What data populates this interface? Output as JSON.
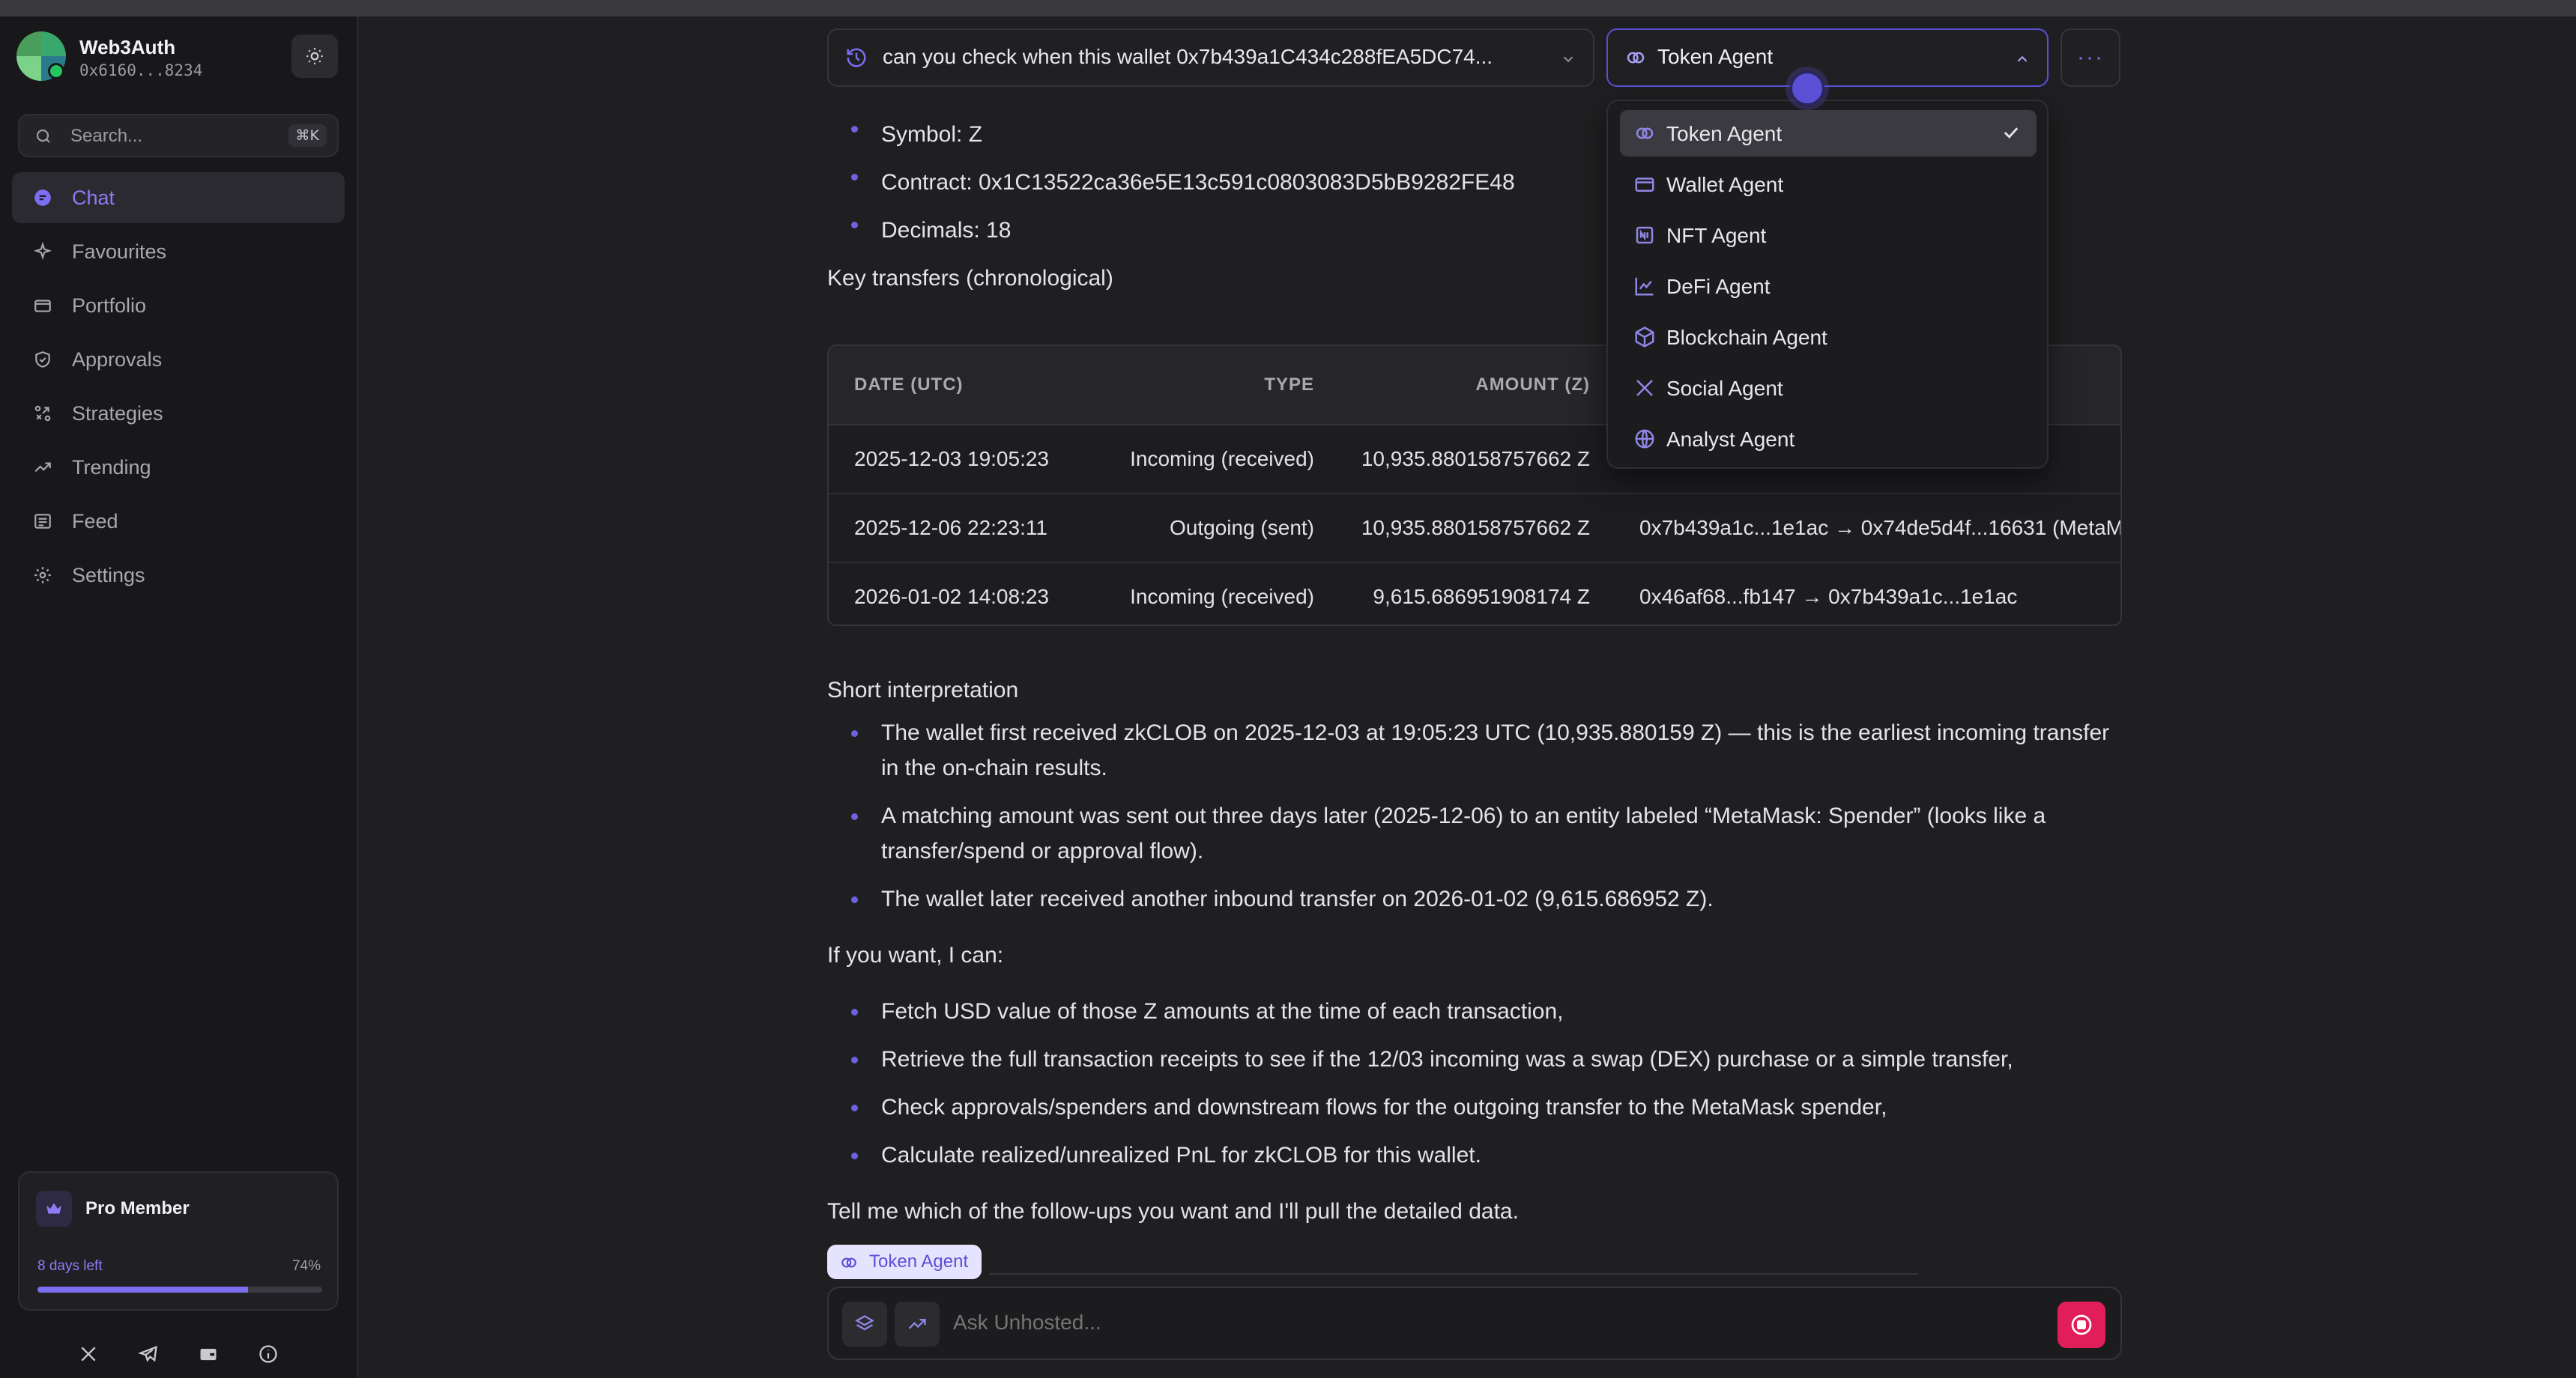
{
  "app": {
    "name": "Web3Auth",
    "address": "0x6160...8234"
  },
  "search": {
    "placeholder": "Search...",
    "shortcut": "⌘K"
  },
  "sidebar": {
    "items": [
      {
        "label": "Chat",
        "icon": "chat-icon",
        "active": true
      },
      {
        "label": "Favourites",
        "icon": "sparkle-icon"
      },
      {
        "label": "Portfolio",
        "icon": "wallet-icon"
      },
      {
        "label": "Approvals",
        "icon": "shield-check-icon"
      },
      {
        "label": "Strategies",
        "icon": "strategy-icon"
      },
      {
        "label": "Trending",
        "icon": "trending-up-icon"
      },
      {
        "label": "Feed",
        "icon": "feed-icon"
      },
      {
        "label": "Settings",
        "icon": "gear-icon"
      }
    ]
  },
  "membership": {
    "title": "Pro Member",
    "days_left": "8 days left",
    "percent": "74%",
    "progress": 0.74
  },
  "header": {
    "query": "can you check when this wallet 0x7b439a1C434c288fEA5DC74...",
    "agent": "Token Agent"
  },
  "dropdown": {
    "items": [
      {
        "label": "Token Agent",
        "icon": "coins-icon",
        "selected": true
      },
      {
        "label": "Wallet Agent",
        "icon": "wallet-icon"
      },
      {
        "label": "NFT Agent",
        "icon": "nft-icon"
      },
      {
        "label": "DeFi Agent",
        "icon": "chart-line-icon"
      },
      {
        "label": "Blockchain Agent",
        "icon": "cube-icon"
      },
      {
        "label": "Social Agent",
        "icon": "x-logo-icon"
      },
      {
        "label": "Analyst Agent",
        "icon": "globe-icon"
      }
    ]
  },
  "message": {
    "token_info": [
      "Symbol: Z",
      "Contract: 0x1C13522ca36e5E13c591c0803083D5bB9282FE48",
      "Decimals: 18"
    ],
    "transfers_heading": "Key transfers (chronological)",
    "table": {
      "headers": [
        "DATE (UTC)",
        "TYPE",
        "AMOUNT (Z)",
        ""
      ],
      "rows": [
        [
          "2025-12-03 19:05:23",
          "Incoming (received)",
          "10,935.880158757662 Z",
          ""
        ],
        [
          "2025-12-06 22:23:11",
          "Outgoing (sent)",
          "10,935.880158757662 Z",
          "0x7b439a1c...1e1ac → 0x74de5d4f...16631 (MetaM"
        ],
        [
          "2026-01-02 14:08:23",
          "Incoming (received)",
          "9,615.686951908174 Z",
          "0x46af68...fb147 → 0x7b439a1c...1e1ac"
        ]
      ]
    },
    "interpretation_heading": "Short interpretation",
    "interpretation": [
      "The wallet first received zkCLOB on 2025-12-03 at 19:05:23 UTC (10,935.880159 Z) — this is the earliest incoming transfer in the on-chain results.",
      "A matching amount was sent out three days later (2025-12-06) to an entity labeled “MetaMask: Spender” (looks like a transfer/spend or approval flow).",
      "The wallet later received another inbound transfer on 2026-01-02 (9,615.686952 Z)."
    ],
    "followups_heading": "If you want, I can:",
    "followups": [
      "Fetch USD value of those Z amounts at the time of each transaction,",
      "Retrieve the full transaction receipts to see if the 12/03 incoming was a swap (DEX) purchase or a simple transfer,",
      "Check approvals/spenders and downstream flows for the outgoing transfer to the MetaMask spender,",
      "Calculate realized/unrealized PnL for zkCLOB for this wallet."
    ],
    "closing": "Tell me which of the follow-ups you want and I'll pull the detailed data."
  },
  "composer": {
    "agent_chip": "Token Agent",
    "placeholder": "Ask Unhosted..."
  },
  "colors": {
    "accent": "#7c6ef0",
    "background": "#1f1f21",
    "sidebar": "#18181a",
    "send": "#e11d5a"
  }
}
